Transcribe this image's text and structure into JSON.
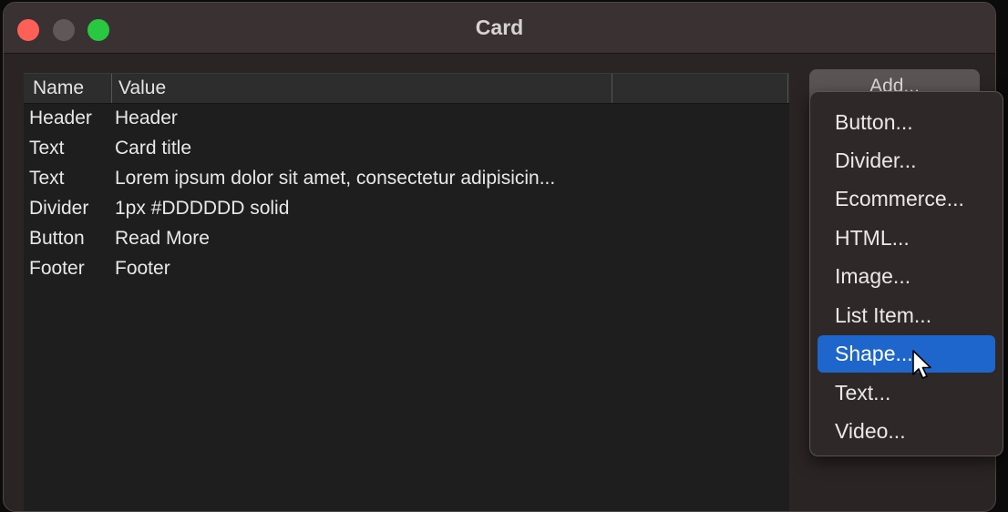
{
  "window": {
    "title": "Card"
  },
  "table": {
    "columns": [
      "Name",
      "Value",
      ""
    ],
    "rows": [
      {
        "name": "Header",
        "value": "Header"
      },
      {
        "name": "Text",
        "value": "Card title"
      },
      {
        "name": "Text",
        "value": "Lorem ipsum dolor sit amet, consectetur adipisicin..."
      },
      {
        "name": "Divider",
        "value": "1px #DDDDDD solid"
      },
      {
        "name": "Button",
        "value": "Read More"
      },
      {
        "name": "Footer",
        "value": "Footer"
      }
    ]
  },
  "add_button": {
    "label": "Add..."
  },
  "menu": {
    "items": [
      "Button...",
      "Divider...",
      "Ecommerce...",
      "HTML...",
      "Image...",
      "List Item...",
      "Shape...",
      "Text...",
      "Video..."
    ],
    "selected": "Shape..."
  },
  "colors": {
    "accent": "#1f66cc",
    "close": "#fe5f57",
    "minimize": "#5f5859",
    "zoom": "#28c840"
  },
  "icons": [
    "close-icon",
    "minimize-icon",
    "zoom-icon",
    "arrow-cursor-icon"
  ]
}
